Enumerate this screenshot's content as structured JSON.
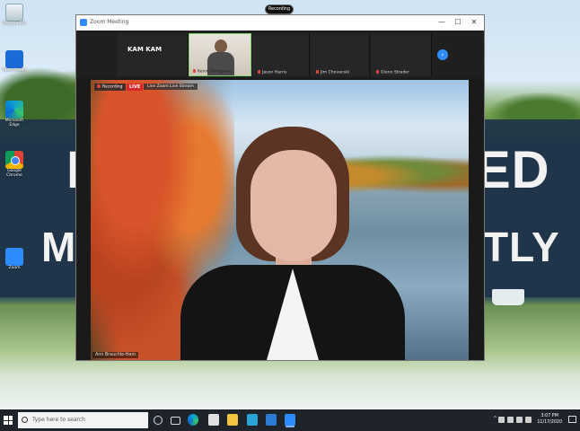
{
  "desktop": {
    "icons": [
      {
        "label": "Recycle Bin",
        "icon": "recycle-bin-icon"
      },
      {
        "label": "TeamViewer",
        "icon": "teamviewer-icon"
      },
      {
        "label": "Microsoft Edge",
        "icon": "edge-icon"
      },
      {
        "label": "Google Chrome",
        "icon": "chrome-icon"
      },
      {
        "label": "Zoom",
        "icon": "zoom-icon"
      }
    ],
    "wallpaper_words": [
      "I",
      "ED",
      "MI",
      "TLY"
    ]
  },
  "recording_pill": {
    "label": "Recording"
  },
  "zoom_window": {
    "title": "Zoom Meeting",
    "controls": {
      "minimize": "—",
      "maximize": "☐",
      "close": "✕"
    },
    "participants": [
      {
        "name": "KAM KAM",
        "caption": ""
      },
      {
        "name": "Kevin Hardgrove",
        "video": true
      },
      {
        "name": "Jason Harris"
      },
      {
        "name": "Jim Chovanski"
      },
      {
        "name": "Glenn Strader"
      }
    ],
    "next_label": "›",
    "main": {
      "recording_label": "Recording",
      "live_label": "LIVE",
      "live_title": "Live Zoom Live Stream",
      "speaker_name": "Ann Brauchle-Hem"
    }
  },
  "taskbar": {
    "search_placeholder": "Type here to search",
    "tray_arrow": "^",
    "time": "3:07 PM",
    "date": "11/17/2020"
  },
  "colors": {
    "zoom_blue": "#2d8cff",
    "live_red": "#d8282b",
    "taskbar": "#1f232a"
  }
}
